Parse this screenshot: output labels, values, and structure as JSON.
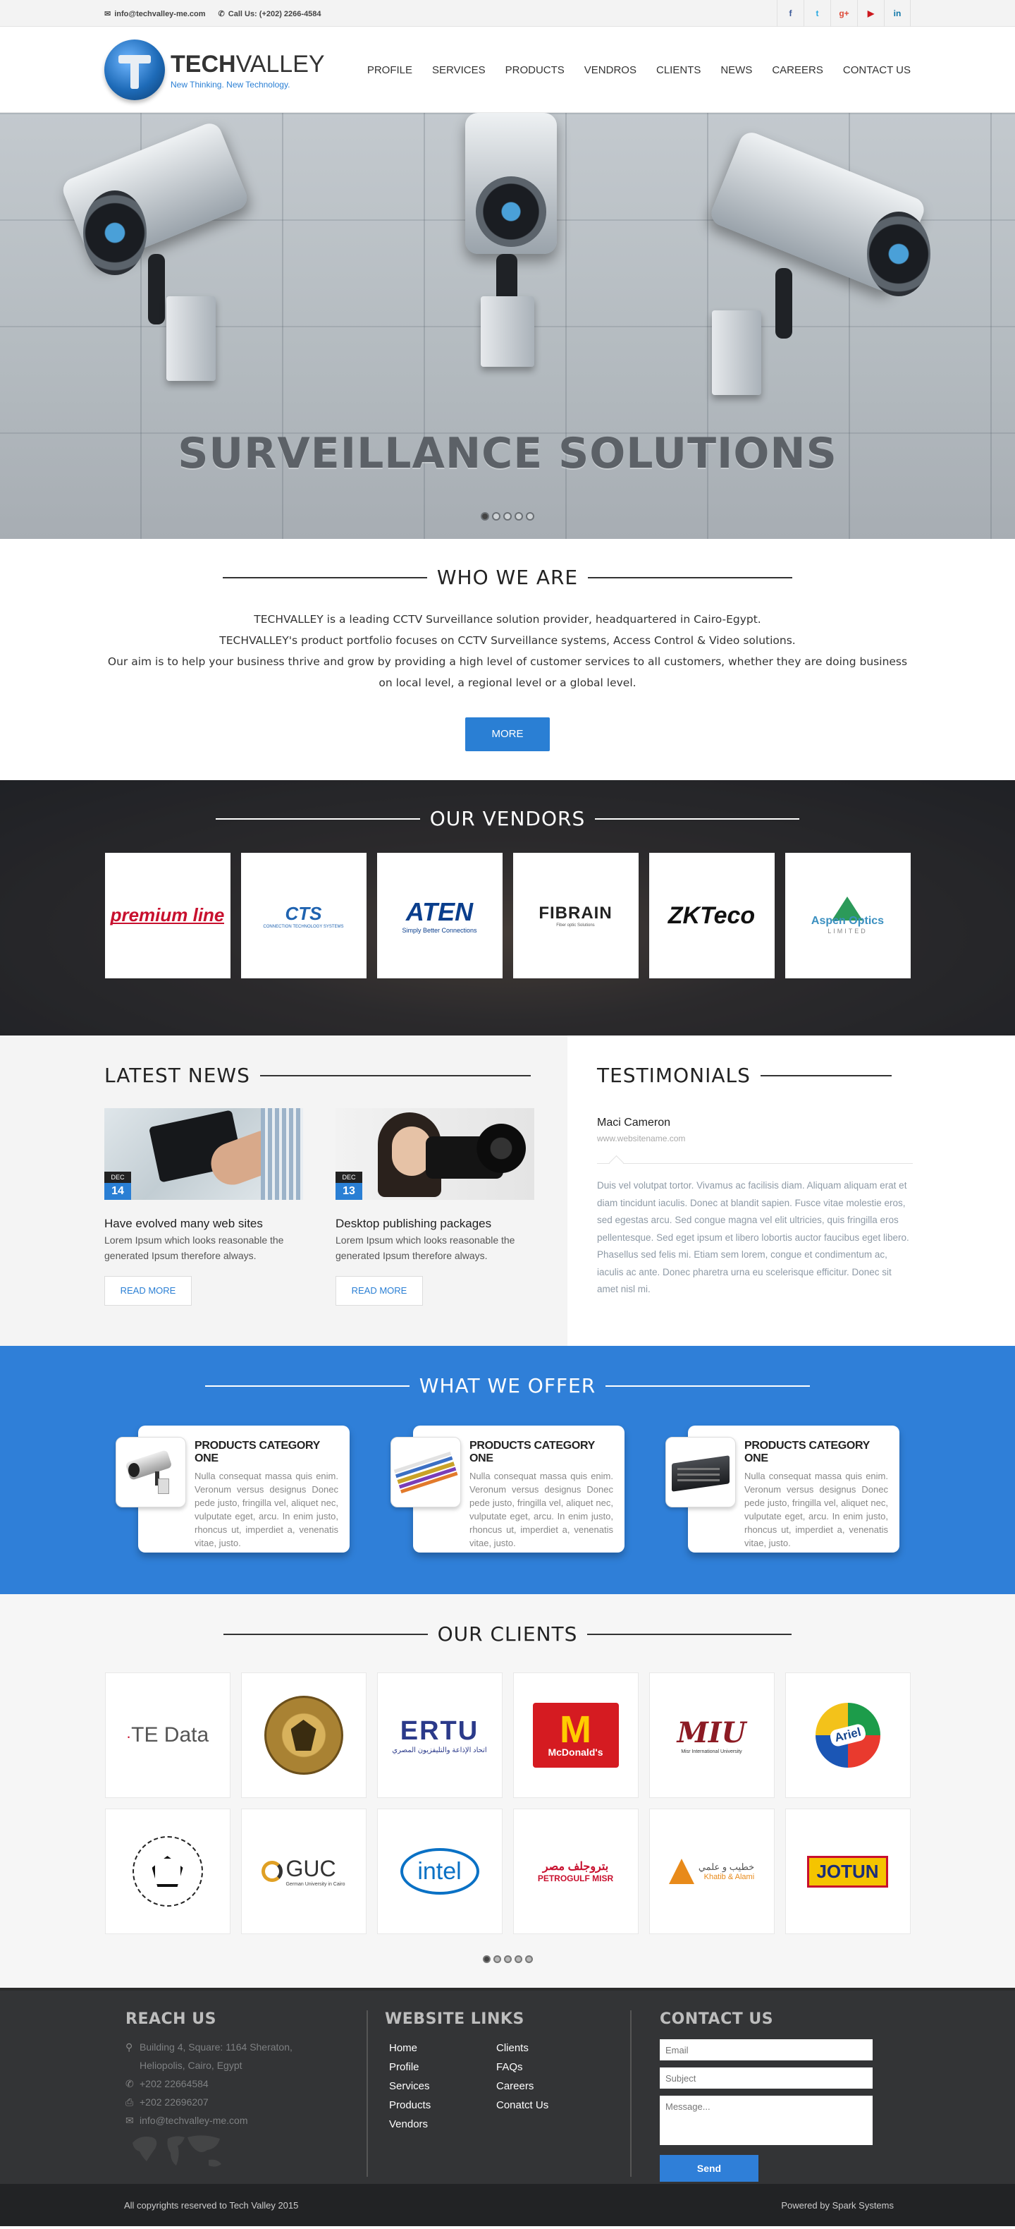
{
  "topbar": {
    "email": "info@techvalley-me.com",
    "phone": "Call Us: (+202) 2266-4584",
    "socials": [
      {
        "icon": "facebook-icon",
        "glyph": "f",
        "color": "#3b5998"
      },
      {
        "icon": "twitter-icon",
        "glyph": "t",
        "color": "#29a9e1"
      },
      {
        "icon": "google-plus-icon",
        "glyph": "g+",
        "color": "#dd4b39"
      },
      {
        "icon": "youtube-icon",
        "glyph": "▶",
        "color": "#cc181e"
      },
      {
        "icon": "linkedin-icon",
        "glyph": "in",
        "color": "#0e76a8"
      }
    ]
  },
  "logo": {
    "name_bold": "TECH",
    "name_light": "VALLEY",
    "tagline": "New Thinking. New Technology."
  },
  "nav": [
    "PROFILE",
    "SERVICES",
    "PRODUCTS",
    "VENDROS",
    "CLIENTS",
    "NEWS",
    "CAREERS",
    "CONTACT US"
  ],
  "hero": {
    "title": "SURVEILLANCE SOLUTIONS",
    "slides": 5,
    "active_slide": 1
  },
  "who": {
    "title": "WHO WE ARE",
    "lines": [
      "TECHVALLEY is a leading CCTV Surveillance solution provider, headquartered in Cairo-Egypt.",
      "TECHVALLEY's product portfolio focuses on CCTV Surveillance systems, Access Control & Video solutions.",
      "Our aim is to help your business thrive and grow by providing a high level of customer services to all customers, whether they are doing business",
      "on local level, a regional level or a global level."
    ],
    "button": "MORE"
  },
  "vendors": {
    "title": "OUR VENDORS",
    "items": [
      "premium line",
      "CTS",
      "ATEN",
      "FIBRAIN",
      "ZKTeco",
      "Aspen Optics"
    ],
    "sublabels": [
      "",
      "CONNECTION TECHNOLOGY SYSTEMS",
      "Simply Better Connections",
      "Fiber optic Solutions",
      "",
      "LIMITED"
    ]
  },
  "news": {
    "title": "LATEST NEWS",
    "read_more": "READ MORE",
    "items": [
      {
        "month": "DEC",
        "day": "14",
        "title": "Have evolved many web sites",
        "text": "Lorem Ipsum which looks reasonable the generated Ipsum therefore always."
      },
      {
        "month": "DEC",
        "day": "13",
        "title": "Desktop publishing packages",
        "text": "Lorem Ipsum which looks reasonable the generated Ipsum therefore always."
      }
    ]
  },
  "testimonials": {
    "title": "TESTIMONIALS",
    "name": "Maci Cameron",
    "site": "www.websitename.com",
    "quote": "Duis vel volutpat tortor. Vivamus ac facilisis diam. Aliquam aliquam erat et diam tincidunt iaculis. Donec at blandit sapien. Fusce vitae molestie eros, sed egestas arcu. Sed congue magna vel elit ultricies, quis fringilla eros pellentesque. Sed eget ipsum et libero lobortis auctor faucibus eget libero. Phasellus sed felis mi. Etiam sem lorem, congue et condimentum ac, iaculis ac ante. Donec pharetra urna eu scelerisque efficitur. Donec sit amet nisl mi."
  },
  "offer": {
    "title": "WHAT WE OFFER",
    "items": [
      {
        "title": "PRODUCTS CATEGORY ONE",
        "thumb": "cctv-camera",
        "text": "Nulla consequat massa quis enim. Veronum versus designus Donec pede justo, fringilla vel, aliquet nec, vulputate eget, arcu. In enim justo, rhoncus ut, imperdiet a, venenatis vitae, justo."
      },
      {
        "title": "PRODUCTS CATEGORY ONE",
        "thumb": "network-cables",
        "text": "Nulla consequat massa quis enim. Veronum versus designus Donec pede justo, fringilla vel, aliquet nec, vulputate eget, arcu. In enim justo, rhoncus ut, imperdiet a, venenatis vitae, justo."
      },
      {
        "title": "PRODUCTS CATEGORY ONE",
        "thumb": "dvr-recorder",
        "text": "Nulla consequat massa quis enim. Veronum versus designus Donec pede justo, fringilla vel, aliquet nec, vulputate eget, arcu. In enim justo, rhoncus ut, imperdiet a, venenatis vitae, justo."
      }
    ]
  },
  "clients": {
    "title": "OUR CLIENTS",
    "items": [
      "TE Data",
      "Egypt Emblem",
      "ERTU",
      "McDonald's",
      "MIU",
      "Ariel",
      "Japan University",
      "GUC",
      "intel",
      "PETROGULF MISR",
      "Khatib & Alami",
      "JOTUN"
    ],
    "sublabels": {
      "ertu": "اتحاد الإذاعة والتليفزيون المصري",
      "miu": "Misr International University",
      "guc": "German University in Cairo",
      "petrogulf_ar": "بتروجلف مصر",
      "khatib_ar": "خطيب و علمي"
    },
    "slides": 5,
    "active_slide": 1
  },
  "footer": {
    "reach": {
      "title": "REACH US",
      "address1": "Building 4, Square: 1164 Sheraton,",
      "address2": "Heliopolis, Cairo, Egypt",
      "phone1": "+202 22664584",
      "phone2": "+202 22696207",
      "email": "info@techvalley-me.com"
    },
    "links": {
      "title": "WEBSITE LINKS",
      "items": [
        "Home",
        "Clients",
        "Profile",
        "FAQs",
        "Services",
        "Careers",
        "Products",
        "Conatct Us",
        "Vendors"
      ]
    },
    "contact": {
      "title": "CONTACT US",
      "email_ph": "Email",
      "subject_ph": "Subject",
      "message_ph": "Message...",
      "send": "Send"
    },
    "copyright": "All copyrights reserved to Tech Valley 2015",
    "powered": "Powered by Spark Systems"
  }
}
